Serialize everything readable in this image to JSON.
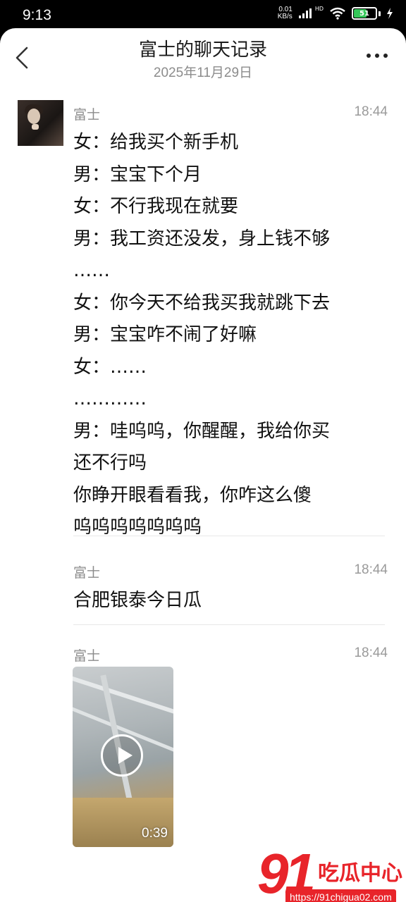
{
  "status_bar": {
    "time": "9:13",
    "net_speed_value": "0.01",
    "net_speed_unit": "KB/s",
    "hd_label": "HD",
    "battery": "51",
    "battery_color": "#35c759"
  },
  "header": {
    "title": "富士的聊天记录",
    "date": "2025年11月29日"
  },
  "messages": [
    {
      "sender": "富士",
      "time": "18:44",
      "lines": [
        "女：给我买个新手机",
        "男：宝宝下个月",
        "女：不行我现在就要",
        "男：我工资还没发，身上钱不够",
        "……",
        "女：你今天不给我买我就跳下去",
        "男：宝宝咋不闹了好嘛",
        "女：……",
        "…………",
        "男：哇呜呜，你醒醒，我给你买",
        "还不行吗",
        "你睁开眼看看我，你咋这么傻",
        "呜呜呜呜呜呜呜"
      ]
    },
    {
      "sender": "富士",
      "time": "18:44",
      "lines": [
        "合肥银泰今日瓜"
      ]
    },
    {
      "sender": "富士",
      "time": "18:44",
      "video_duration": "0:39"
    }
  ],
  "watermark": {
    "number": "91",
    "name": "吃瓜中心",
    "url": "https://91chigua02.com",
    "color": "#e8242a"
  }
}
